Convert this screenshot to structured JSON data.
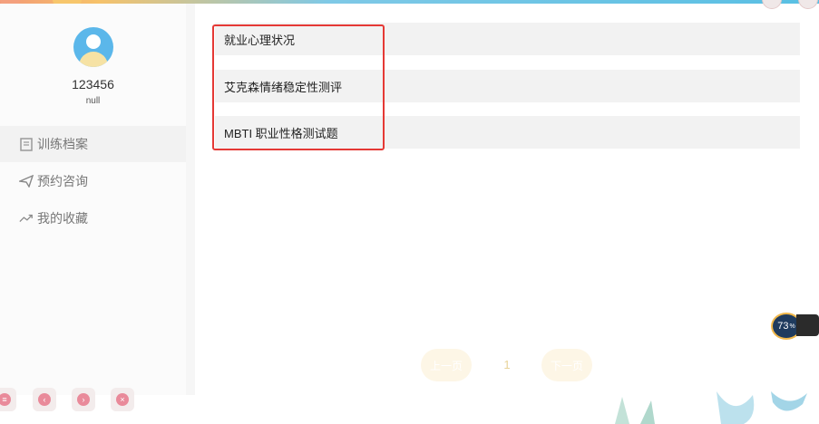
{
  "user": {
    "name": "123456",
    "subtitle": "null"
  },
  "menu": [
    {
      "label": "训练档案",
      "icon": "document-icon",
      "active": true
    },
    {
      "label": "预约咨询",
      "icon": "paper-plane-icon",
      "active": false
    },
    {
      "label": "我的收藏",
      "icon": "trend-icon",
      "active": false
    }
  ],
  "list": [
    {
      "label": "就业心理状况"
    },
    {
      "label": "艾克森情绪稳定性测评"
    },
    {
      "label": "MBTI 职业性格测试题"
    }
  ],
  "pager": {
    "prev": "上一页",
    "page": "1",
    "next": "下一页"
  },
  "speed": {
    "value": "73",
    "unit": "%"
  }
}
